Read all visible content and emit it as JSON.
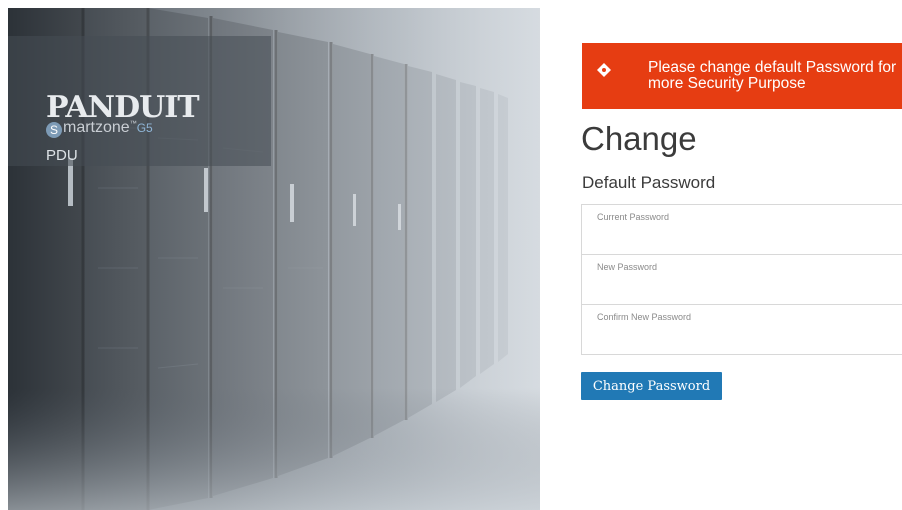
{
  "brand": {
    "logo_text": "PANDUIT",
    "product_initial": "S",
    "product_rest": "martzone",
    "product_tm": "™",
    "product_suffix": "G5",
    "device_label": "PDU"
  },
  "alert": {
    "icon": "alert-diamond-icon",
    "message": "Please change default Password for more Security Purpose",
    "background": "#e63d12"
  },
  "page": {
    "title": "Change",
    "subtitle": "Default Password"
  },
  "form": {
    "current_password": {
      "placeholder": "Current Password",
      "value": ""
    },
    "new_password": {
      "placeholder": "New Password",
      "value": ""
    },
    "confirm_password": {
      "placeholder": "Confirm New Password",
      "value": ""
    },
    "submit_label": "Change Password",
    "submit_color": "#2179b5"
  }
}
